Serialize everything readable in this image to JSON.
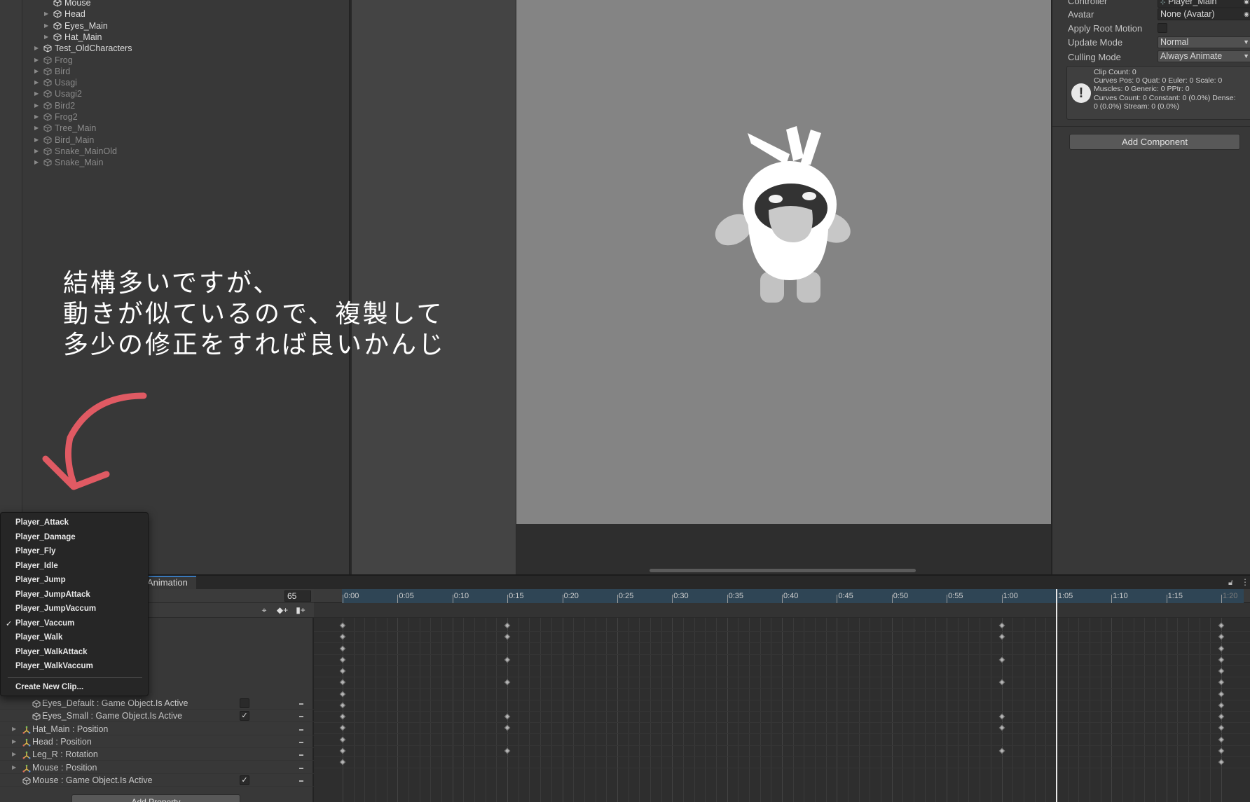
{
  "hierarchy": {
    "items": [
      {
        "label": "Mouse",
        "level": 2,
        "dim": false
      },
      {
        "label": "Head",
        "level": 2,
        "dim": false
      },
      {
        "label": "Eyes_Main",
        "level": 2,
        "dim": false
      },
      {
        "label": "Hat_Main",
        "level": 2,
        "dim": false
      },
      {
        "label": "Test_OldCharacters",
        "level": 1,
        "dim": false
      },
      {
        "label": "Frog",
        "level": 1,
        "dim": true
      },
      {
        "label": "Bird",
        "level": 1,
        "dim": true
      },
      {
        "label": "Usagi",
        "level": 1,
        "dim": true
      },
      {
        "label": "Usagi2",
        "level": 1,
        "dim": true
      },
      {
        "label": "Bird2",
        "level": 1,
        "dim": true
      },
      {
        "label": "Frog2",
        "level": 1,
        "dim": true
      },
      {
        "label": "Tree_Main",
        "level": 1,
        "dim": true
      },
      {
        "label": "Bird_Main",
        "level": 1,
        "dim": true
      },
      {
        "label": "Snake_MainOld",
        "level": 1,
        "dim": true
      },
      {
        "label": "Snake_Main",
        "level": 1,
        "dim": true
      }
    ]
  },
  "inspector": {
    "controller_label": "Controller",
    "controller_value": "Player_Main",
    "avatar_label": "Avatar",
    "avatar_value": "None (Avatar)",
    "apply_root_motion_label": "Apply Root Motion",
    "update_mode_label": "Update Mode",
    "update_mode_value": "Normal",
    "culling_mode_label": "Culling Mode",
    "culling_mode_value": "Always Animate",
    "info_lines": [
      "Clip Count: 0",
      "Curves Pos: 0 Quat: 0 Euler: 0 Scale: 0",
      "Muscles: 0 Generic: 0 PPtr: 0",
      "Curves Count: 0 Constant: 0 (0.0%) Dense:",
      "0 (0.0%) Stream: 0 (0.0%)"
    ],
    "add_component_label": "Add Component"
  },
  "annotation": {
    "text": "結構多いですが、\n動きが似ているので、複製して\n多少の修正をすれば良いかんじ",
    "arrow_color": "#e05a63"
  },
  "animation": {
    "tab_label": "Animation",
    "frame_value": "65",
    "properties": [
      {
        "label": "Eyes_Default : Game Object.Is Active",
        "type": "active",
        "expand": false,
        "checked": false
      },
      {
        "label": "Eyes_Small : Game Object.Is Active",
        "type": "active",
        "expand": false,
        "checked": true
      },
      {
        "label": "Hat_Main : Position",
        "type": "transform",
        "expand": true,
        "checked": null
      },
      {
        "label": "Head : Position",
        "type": "transform",
        "expand": true,
        "checked": null
      },
      {
        "label": "Leg_R : Rotation",
        "type": "transform",
        "expand": true,
        "checked": null
      },
      {
        "label": "Mouse : Position",
        "type": "transform",
        "expand": true,
        "checked": null
      },
      {
        "label": "Mouse : Game Object.Is Active",
        "type": "active",
        "expand": false,
        "checked": true
      }
    ],
    "add_property_label": "Add Property",
    "time_ticks": [
      "0:00",
      "0:05",
      "0:10",
      "0:15",
      "0:20",
      "0:25",
      "0:30",
      "0:35",
      "0:40",
      "0:45",
      "0:50",
      "0:55",
      "1:00",
      "1:05",
      "1:10",
      "1:15",
      "1:20"
    ],
    "playhead_time": "1:05",
    "key_rows": [
      [
        0,
        15,
        60,
        80
      ],
      [
        0,
        15,
        60,
        80
      ],
      [
        0,
        80
      ],
      [
        0,
        15,
        60,
        80
      ],
      [
        0,
        80
      ],
      [
        0,
        15,
        60,
        80
      ],
      [
        0,
        80
      ],
      [
        0,
        80
      ],
      [
        0,
        15,
        60,
        80
      ],
      [
        0,
        15,
        60,
        80
      ],
      [
        0,
        80
      ],
      [
        0,
        15,
        60,
        80
      ],
      [
        0,
        80
      ]
    ]
  },
  "clip_menu": {
    "items": [
      "Player_Attack",
      "Player_Damage",
      "Player_Fly",
      "Player_Idle",
      "Player_Jump",
      "Player_JumpAttack",
      "Player_JumpVaccum",
      "Player_Vaccum",
      "Player_Walk",
      "Player_WalkAttack",
      "Player_WalkVaccum"
    ],
    "selected": "Player_Vaccum",
    "create_label": "Create New Clip..."
  }
}
